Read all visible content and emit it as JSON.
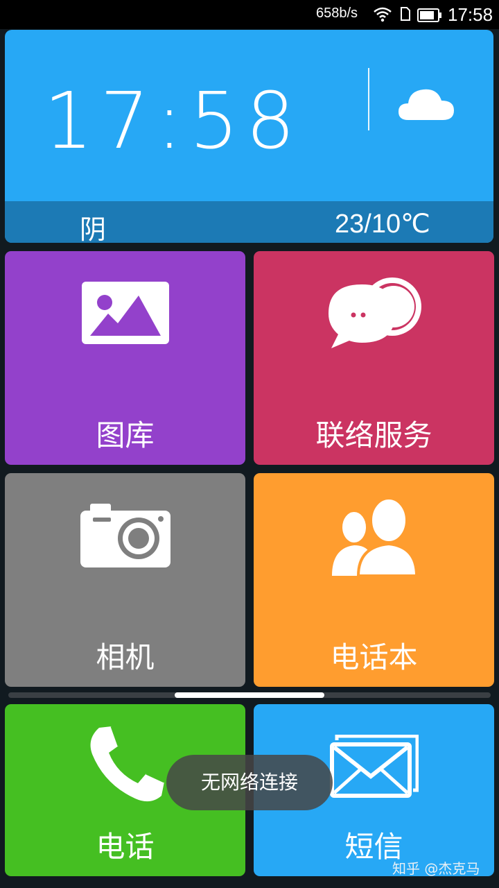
{
  "status_bar": {
    "network_speed": "658b/s",
    "time": "17:58",
    "icons": [
      "wifi-icon",
      "sim-icon",
      "battery-icon"
    ]
  },
  "clock_widget": {
    "time": "17:58",
    "weather_icon": "cloud-icon",
    "condition": "阴",
    "temperature": "23/10℃"
  },
  "tiles": [
    {
      "label": "图库",
      "icon": "gallery-icon",
      "color": "#9341cb"
    },
    {
      "label": "联络服务",
      "icon": "chat-bubbles-icon",
      "color": "#cb3462"
    },
    {
      "label": "相机",
      "icon": "camera-icon",
      "color": "#7f7f7f"
    },
    {
      "label": "电话本",
      "icon": "contacts-icon",
      "color": "#ff9d2f"
    },
    {
      "label": "电话",
      "icon": "phone-icon",
      "color": "#45bf22"
    },
    {
      "label": "短信",
      "icon": "envelope-icon",
      "color": "#27a8f5"
    }
  ],
  "toast": "无网络连接",
  "watermark": "知乎 @杰克马"
}
